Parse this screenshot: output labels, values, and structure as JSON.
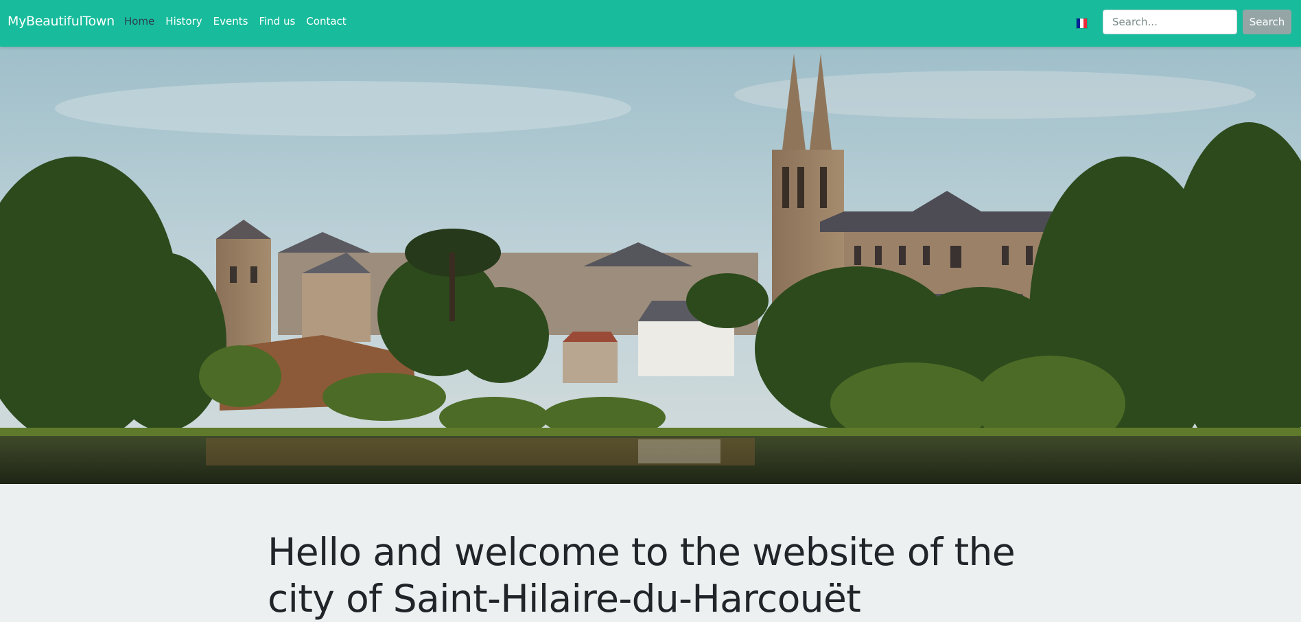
{
  "navbar": {
    "brand": "MyBeautifulTown",
    "links": [
      {
        "label": "Home",
        "active": true
      },
      {
        "label": "History",
        "active": false
      },
      {
        "label": "Events",
        "active": false
      },
      {
        "label": "Find us",
        "active": false
      },
      {
        "label": "Contact",
        "active": false
      }
    ],
    "language_flag": "french-flag-icon",
    "search": {
      "placeholder": "Search...",
      "value": "",
      "button_label": "Search"
    }
  },
  "hero": {
    "image": "town-lake-cathedral-photo"
  },
  "content": {
    "headline": "Hello and welcome to the website of the city of Saint-Hilaire-du-Harcouët"
  },
  "colors": {
    "navbar": "#18bc9c",
    "active_link": "#2c3e50",
    "search_button": "#95a5a6",
    "page_background": "#ecf0f1",
    "headline_text": "#212529"
  }
}
